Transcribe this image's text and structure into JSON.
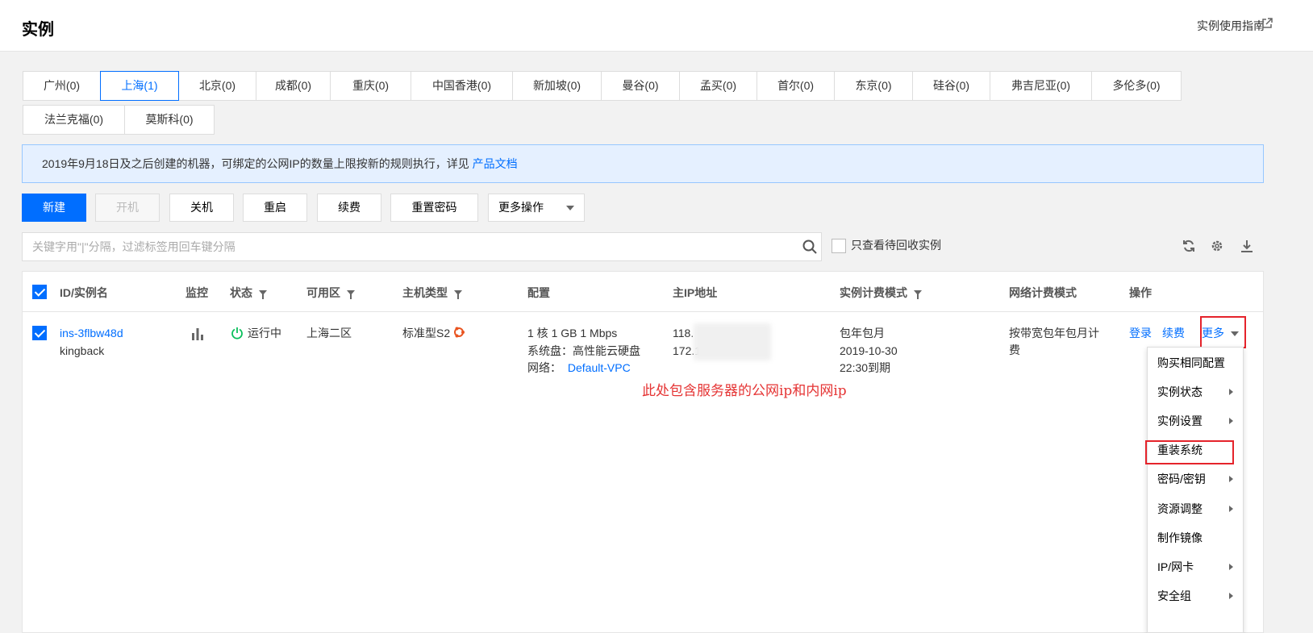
{
  "header": {
    "title": "实例",
    "guide_link": "实例使用指南"
  },
  "regions": [
    {
      "label": "广州(0)"
    },
    {
      "label": "上海(1)",
      "active": true
    },
    {
      "label": "北京(0)"
    },
    {
      "label": "成都(0)"
    },
    {
      "label": "重庆(0)"
    },
    {
      "label": "中国香港(0)"
    },
    {
      "label": "新加坡(0)"
    },
    {
      "label": "曼谷(0)"
    },
    {
      "label": "孟买(0)"
    },
    {
      "label": "首尔(0)"
    },
    {
      "label": "东京(0)"
    },
    {
      "label": "硅谷(0)"
    },
    {
      "label": "弗吉尼亚(0)"
    },
    {
      "label": "多伦多(0)"
    },
    {
      "label": "法兰克福(0)"
    },
    {
      "label": "莫斯科(0)"
    }
  ],
  "notice": {
    "text": "2019年9月18日及之后创建的机器，可绑定的公网IP的数量上限按新的规则执行，详见 ",
    "link": "产品文档"
  },
  "toolbar": {
    "new": "新建",
    "start": "开机",
    "stop": "关机",
    "restart": "重启",
    "renew": "续费",
    "reset_password": "重置密码",
    "more_actions": "更多操作"
  },
  "search": {
    "placeholder": "关键字用\"|\"分隔，过滤标签用回车键分隔",
    "value": ""
  },
  "recycle_filter": {
    "label": "只查看待回收实例",
    "checked": false
  },
  "table": {
    "headers": {
      "id": "ID/实例名",
      "monitor": "监控",
      "status": "状态",
      "zone": "可用区",
      "type": "主机类型",
      "config": "配置",
      "ip": "主IP地址",
      "billing": "实例计费模式",
      "net_billing": "网络计费模式",
      "ops": "操作"
    },
    "row": {
      "id": "ins-3flbw48d",
      "name": "kingback",
      "status": "运行中",
      "zone": "上海二区",
      "type": "标准型S2",
      "config_cpu": "1 核 1 GB 1 Mbps",
      "config_disk": "系统盘：高性能云硬盘",
      "config_net_label": "网络：",
      "config_net_link": "Default-VPC",
      "ip_public": "118.",
      "ip_private": "172.1",
      "billing_mode": "包年包月",
      "billing_date": "2019-10-30",
      "billing_expire": "22:30到期",
      "net_billing": "按带宽包年包月计费",
      "op_login": "登录",
      "op_renew": "续费",
      "op_more": "更多"
    }
  },
  "annotation": "此处包含服务器的公网ip和内网ip",
  "more_menu": [
    {
      "label": "购买相同配置",
      "submenu": false
    },
    {
      "label": "实例状态",
      "submenu": true
    },
    {
      "label": "实例设置",
      "submenu": true
    },
    {
      "label": "重装系统",
      "submenu": false
    },
    {
      "label": "密码/密钥",
      "submenu": true
    },
    {
      "label": "资源调整",
      "submenu": true
    },
    {
      "label": "制作镜像",
      "submenu": false
    },
    {
      "label": "IP/网卡",
      "submenu": true
    },
    {
      "label": "安全组",
      "submenu": true
    }
  ],
  "colors": {
    "accent": "#006eff",
    "running": "#0abf5b",
    "annotation": "#e53333",
    "highlight_box": "#e5232b"
  }
}
